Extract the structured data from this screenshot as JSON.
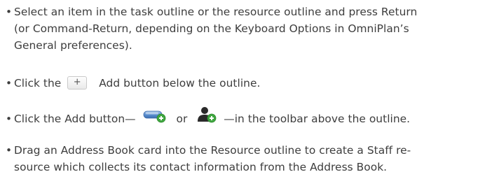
{
  "bullets": {
    "item1_line1": "Select an item in the task outline or the resource outline and press Return",
    "item1_line2": "(or Command-Return, depending on the Keyboard Options in OmniPlan’s",
    "item1_line3": "General preferences).",
    "item2_pre": "Click the",
    "item2_button_label": "+",
    "item2_post": "Add button below the outline.",
    "item3_pre": "Click the Add button—",
    "item3_mid": "or",
    "item3_post": "—in the toolbar above the outline.",
    "item4_line1": "Drag an Address Book card into the Resource outline to create a Staff re-",
    "item4_line2": "source which collects its contact information from the Address Book."
  },
  "icons": {
    "add_task": "add-task-toolbar-icon",
    "add_resource": "add-resource-toolbar-icon",
    "add_badge": "green-plus-badge-icon"
  },
  "colors": {
    "text": "#3d3d3d",
    "task_blue": "#5b8fd0",
    "badge_green": "#3fa63f",
    "person_dark": "#2a2a2a"
  }
}
